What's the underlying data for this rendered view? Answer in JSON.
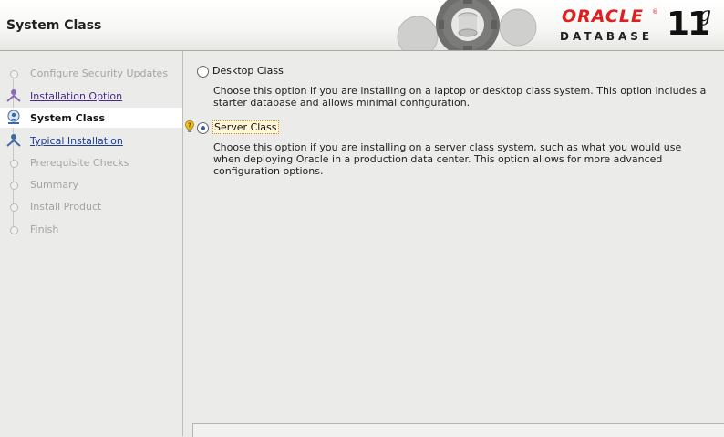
{
  "header": {
    "title": "System Class",
    "brand": "ORACLE",
    "product": "DATABASE",
    "version_number": "11",
    "version_letter": "g"
  },
  "steps": [
    {
      "label": "Configure Security Updates",
      "state": "disabled"
    },
    {
      "label": "Installation Option",
      "state": "visited"
    },
    {
      "label": "System Class",
      "state": "current"
    },
    {
      "label": "Typical Installation",
      "state": "link"
    },
    {
      "label": "Prerequisite Checks",
      "state": "disabled"
    },
    {
      "label": "Summary",
      "state": "disabled"
    },
    {
      "label": "Install Product",
      "state": "disabled"
    },
    {
      "label": "Finish",
      "state": "disabled"
    }
  ],
  "options": {
    "desktop": {
      "label": "Desktop Class",
      "selected": false,
      "description": "Choose this option if you are installing on a laptop or desktop class system. This option includes a starter database and allows minimal configuration."
    },
    "server": {
      "label": "Server Class",
      "selected": true,
      "description": "Choose this option if you are installing on a server class system, such as what you would use when deploying Oracle in a production data center. This option allows for more advanced configuration options."
    }
  },
  "icons": {
    "hint": "help-hint-icon",
    "gears": "gears-icon",
    "step": "step-person-icon"
  },
  "colors": {
    "brand_red": "#e01e1e",
    "visited_link": "#4a2a8a",
    "link": "#1d3f9a",
    "disabled_text": "#a4a4a4"
  }
}
